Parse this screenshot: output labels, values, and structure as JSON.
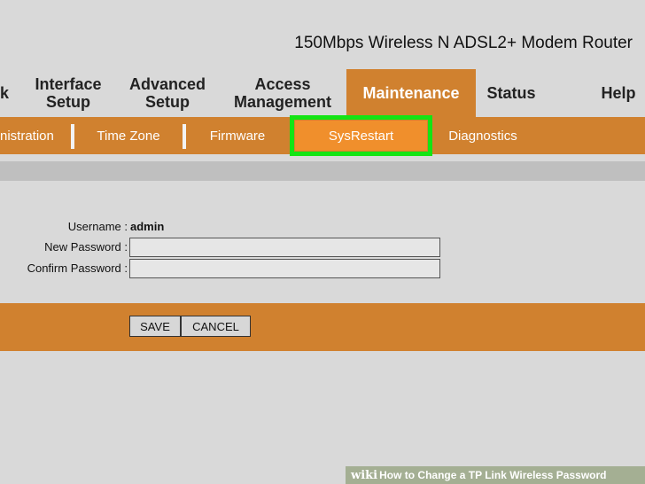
{
  "header": {
    "title": "150Mbps Wireless N ADSL2+ Modem Router"
  },
  "mainnav": {
    "partial_left": "k",
    "tabs": [
      {
        "lines": [
          "Interface",
          "Setup"
        ]
      },
      {
        "lines": [
          "Advanced",
          "Setup"
        ]
      },
      {
        "lines": [
          "Access",
          "Management"
        ]
      },
      {
        "lines": [
          "Maintenance"
        ],
        "active": true
      },
      {
        "lines": [
          "Status"
        ]
      },
      {
        "lines": [
          "Help"
        ]
      }
    ]
  },
  "subnav": {
    "items": [
      {
        "label": "nistration"
      },
      {
        "label": "Time Zone"
      },
      {
        "label": "Firmware"
      },
      {
        "label": "SysRestart",
        "active": true
      },
      {
        "label": "Diagnostics"
      }
    ]
  },
  "form": {
    "username_label": "Username :",
    "username_value": "admin",
    "new_password_label": "New Password :",
    "new_password_value": "",
    "confirm_password_label": "Confirm Password :",
    "confirm_password_value": ""
  },
  "actions": {
    "save": "SAVE",
    "cancel": "CANCEL"
  },
  "watermark": {
    "brand": "wiki",
    "text": "How to Change a TP Link Wireless Password"
  },
  "colors": {
    "accent": "#d0812f",
    "highlight": "#14e414",
    "active_sub": "#f08f2c"
  }
}
